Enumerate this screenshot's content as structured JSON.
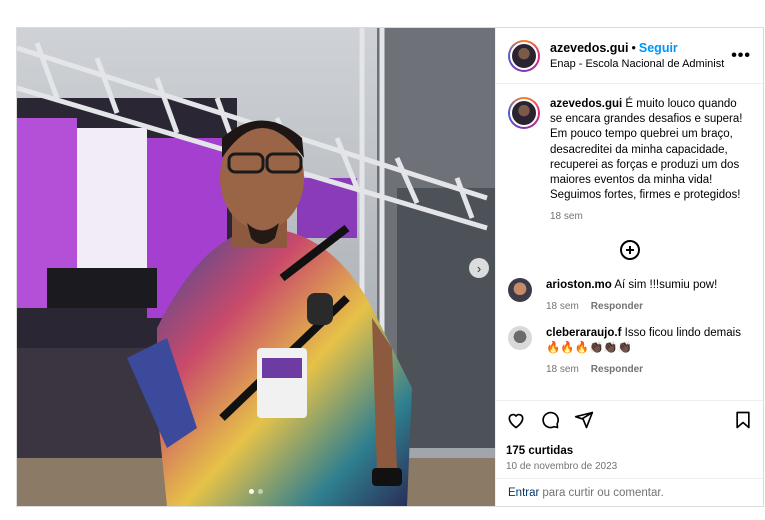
{
  "post": {
    "username": "azevedos.gui",
    "follow_label": "Seguir",
    "location": "Enap - Escola Nacional de Administração",
    "caption": "É muito louco quando se encara grandes desafios e supera! Em pouco tempo quebrei um braço, desacreditei da minha capacidade, recuperei as forças e produzi um dos maiores eventos da minha vida! Seguimos fortes, firmes e protegidos!",
    "caption_time": "18 sem",
    "likes": "175 curtidas",
    "date": "10 de novembro de 2023",
    "add_comment_link": "Entrar",
    "add_comment_text": "para curtir ou comentar."
  },
  "comments": [
    {
      "user": "arioston.mo",
      "text": "Aí sim !!!sumiu pow!",
      "time": "18 sem",
      "reply": "Responder"
    },
    {
      "user": "cleberaraujo.f",
      "text": "Isso ficou lindo demais 🔥🔥🔥👏🏿👏🏿👏🏿",
      "time": "18 sem",
      "reply": "Responder"
    }
  ],
  "icons": {
    "more": "more-options-icon",
    "add": "load-more-comments-icon",
    "like": "heart-icon",
    "comment": "comment-icon",
    "share": "share-icon",
    "save": "bookmark-icon",
    "next": "chevron-right-icon"
  },
  "colors": {
    "accent": "#0095f6",
    "secondary_text": "#737373",
    "border": "#dbdbdb"
  }
}
